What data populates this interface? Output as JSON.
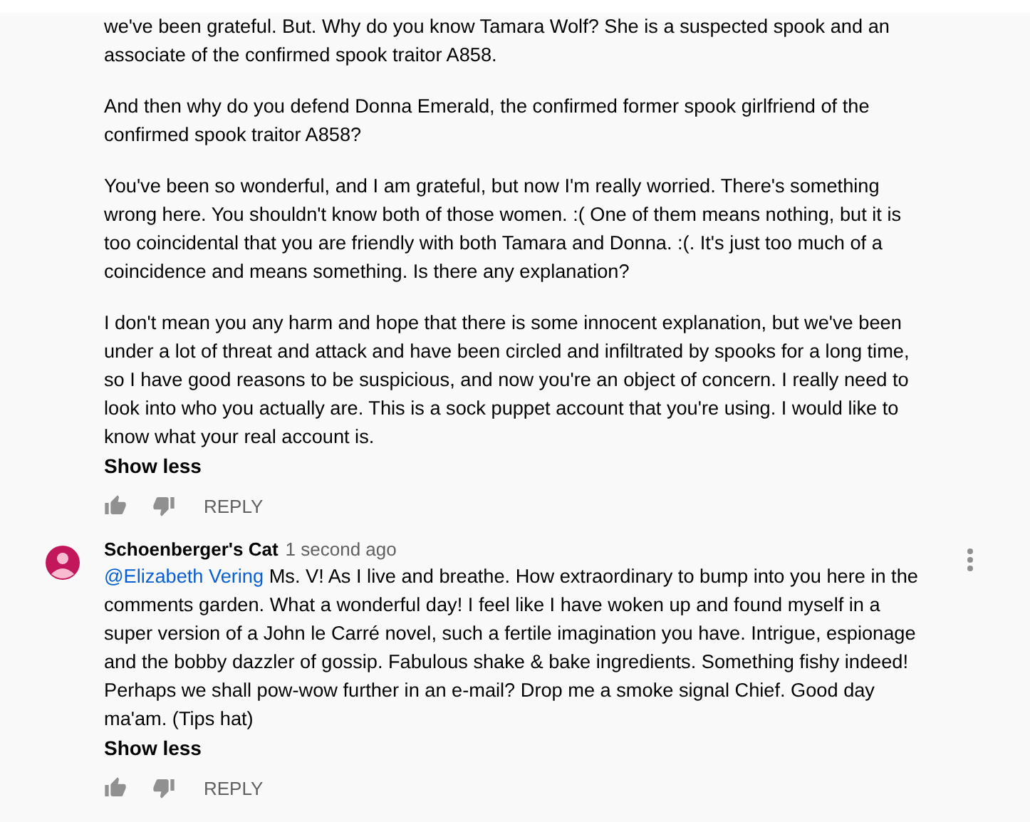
{
  "comments": [
    {
      "paragraphs": [
        "we've been grateful.  But.  Why do you know Tamara Wolf?  She is a suspected spook and an associate of the confirmed spook traitor A858.",
        "And then why do you defend Donna Emerald, the confirmed former spook girlfriend of the confirmed spook traitor A858?",
        "You've been so wonderful, and I am grateful, but now I'm really worried.  There's something wrong here.  You shouldn't know both of those women. :(   One of them means nothing, but it is too coincidental that you are friendly with both Tamara and Donna.  :(.  It's just too much of a coincidence and means something.  Is there any explanation?",
        "I don't mean you any harm and hope that there is some innocent explanation, but we've been under a lot of threat and attack and have been circled and infiltrated by spooks for a long time, so I have good reasons to be suspicious, and now you're an object of concern.  I really need to look into who you actually are.  This is a sock puppet account that you're using.  I would like to know what your real account is."
      ],
      "toggle": "Show less",
      "reply": "REPLY"
    },
    {
      "author": "Schoenberger's Cat",
      "time": "1 second ago",
      "mention": "@Elizabeth Vering",
      "paragraphs": [
        "Ms. V! As I live and breathe. How extraordinary to bump into you here in the comments garden. What a wonderful day! I feel like I have woken up and found myself in a super version of a John le Carré novel, such a fertile imagination you have. Intrigue, espionage and the bobby dazzler of gossip. Fabulous shake & bake ingredients. Something fishy indeed! Perhaps we shall pow-wow further in an e-mail? Drop me a smoke signal Chief. Good day ma'am. (Tips hat)"
      ],
      "toggle": "Show less",
      "reply": "REPLY"
    }
  ]
}
